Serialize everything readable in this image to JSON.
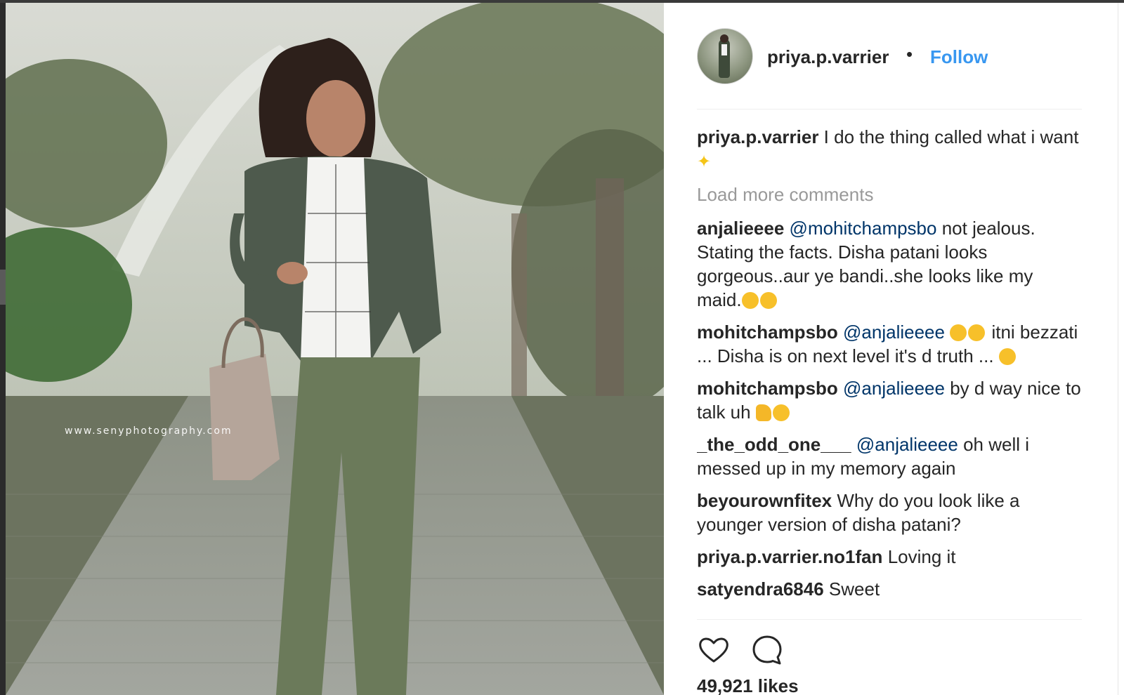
{
  "photo": {
    "watermark": "www.senyphotography.com"
  },
  "header": {
    "username": "priya.p.varrier",
    "separator": "•",
    "follow_label": "Follow"
  },
  "caption": {
    "username": "priya.p.varrier",
    "text": "I do the thing called what i want"
  },
  "load_more": "Load more comments",
  "comments": [
    {
      "username": "anjalieeee",
      "mention": "@mohitchampsbo",
      "text": "not jealous. Stating the facts. Disha patani looks gorgeous..aur ye bandi..she looks like my maid."
    },
    {
      "username": "mohitchampsbo",
      "mention": "@anjalieeee",
      "text_pre": "",
      "text": "itni bezzati ... Disha is on next level it's d truth ..."
    },
    {
      "username": "mohitchampsbo",
      "mention": "@anjalieeee",
      "text": "by d way nice to talk uh"
    },
    {
      "username": "_the_odd_one___",
      "mention": "@anjalieeee",
      "text": "oh well i messed up in my memory again"
    },
    {
      "username": "beyourownfitex",
      "mention": "",
      "text": "Why do you look like a younger version of disha patani?"
    },
    {
      "username": "priya.p.varrier.no1fan",
      "mention": "",
      "text": "Loving it"
    },
    {
      "username": "satyendra6846",
      "mention": "",
      "text": "Sweet"
    }
  ],
  "likes": "49,921 likes",
  "icons": {
    "like": "heart-icon",
    "comment": "comment-bubble-icon"
  },
  "colors": {
    "follow": "#3897f0",
    "mention": "#003569",
    "muted": "#999999",
    "text": "#262626"
  }
}
